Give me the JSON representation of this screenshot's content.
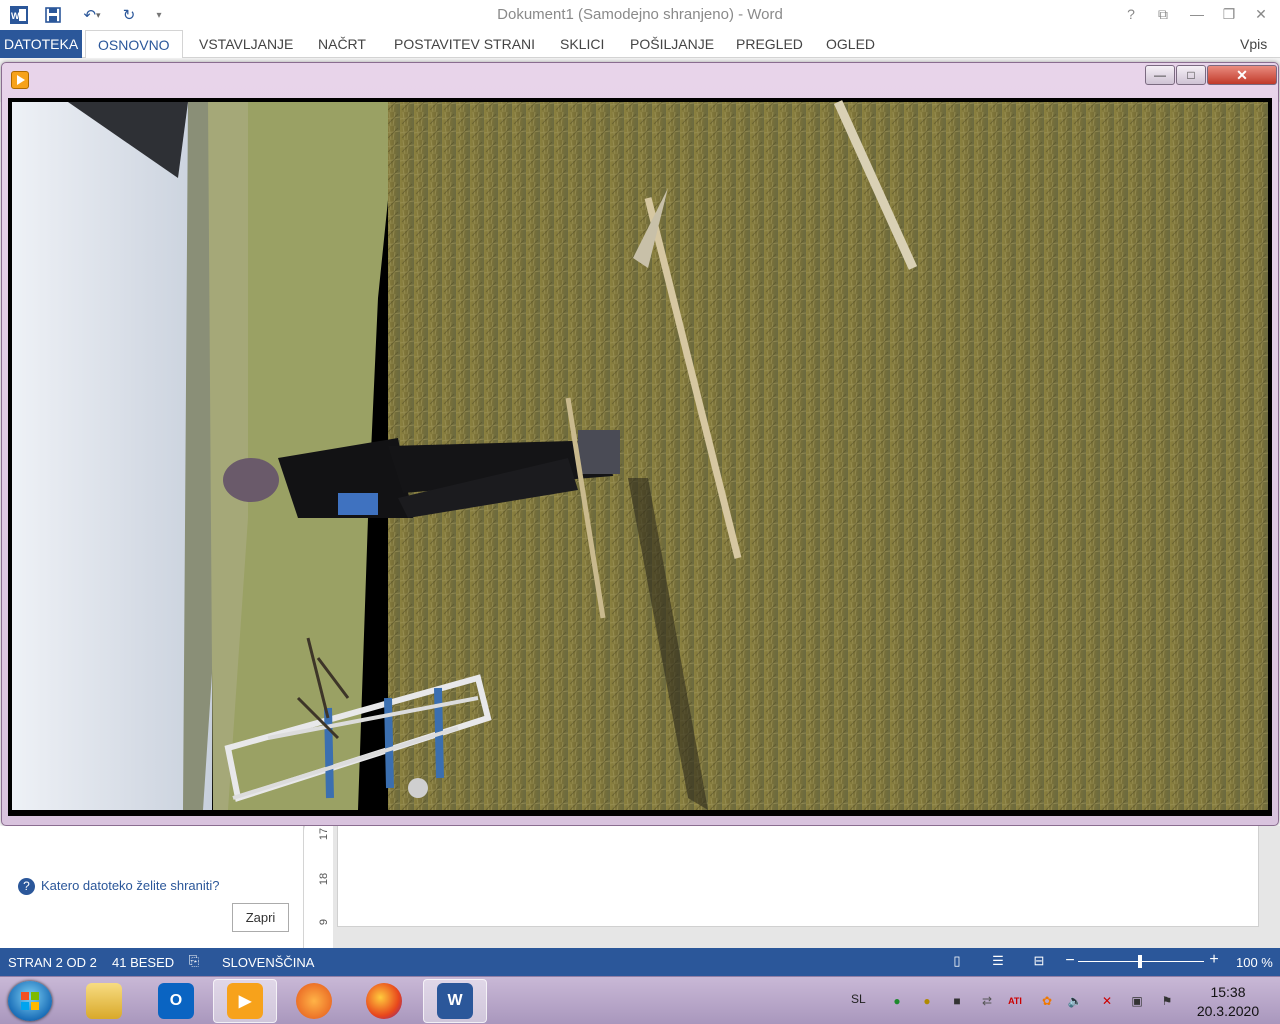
{
  "window": {
    "title": "Dokument1 (Samodejno shranjeno) - Word",
    "help_label": "?"
  },
  "ribbon": {
    "tabs": [
      "DATOTEKA",
      "OSNOVNO",
      "VSTAVLJANJE",
      "NAČRT",
      "POSTAVITEV STRANI",
      "SKLICI",
      "POŠILJANJE",
      "PREGLED",
      "OGLED"
    ],
    "right_label": "Vpis"
  },
  "player": {
    "close_label": "✕",
    "min_label": "—",
    "max_label": "□"
  },
  "save_pane": {
    "question": "Katero datoteko želite shraniti?",
    "close_button": "Zapri"
  },
  "ruler": {
    "numbers": [
      "17",
      "18",
      "9"
    ]
  },
  "statusbar": {
    "page": "STRAN 2 OD 2",
    "words": "41 BESED",
    "language": "SLOVENŠČINA",
    "zoom": "100 %"
  },
  "taskbar": {
    "language": "SL",
    "time": "15:38",
    "date": "20.3.2020",
    "apps": [
      "file-explorer",
      "outlook",
      "video-player",
      "media",
      "firefox",
      "word"
    ]
  },
  "colors": {
    "accent": "#2b579a",
    "player_frame": "#e0cde4",
    "taskbar": "#b8a6c9"
  }
}
